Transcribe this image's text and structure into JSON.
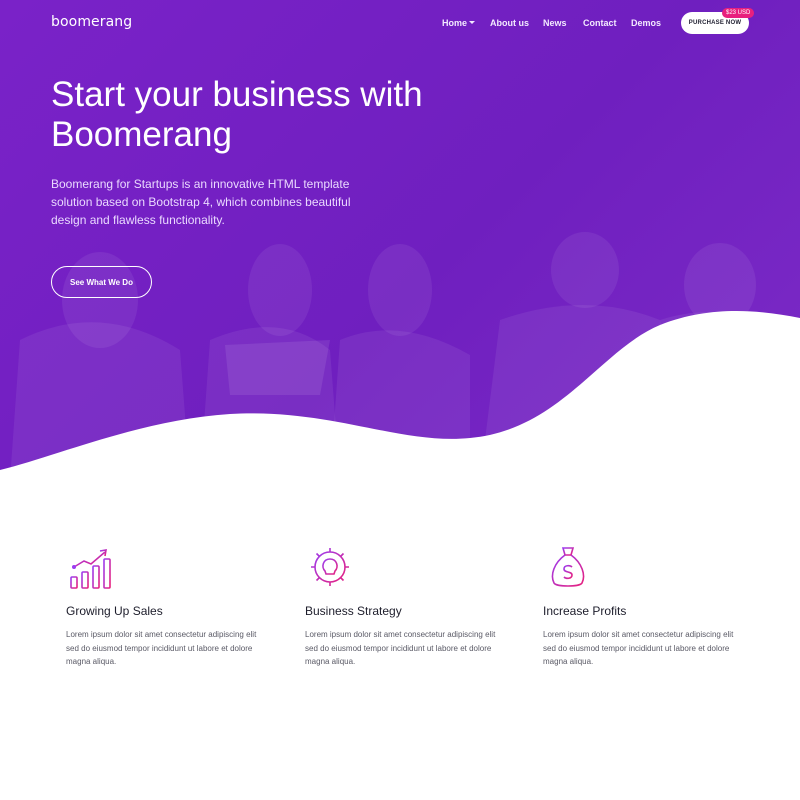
{
  "nav": {
    "logo": "boomerang",
    "items": [
      {
        "label": "Home",
        "has_dropdown": true
      },
      {
        "label": "About us"
      },
      {
        "label": "News"
      },
      {
        "label": "Contact"
      },
      {
        "label": "Demos"
      }
    ],
    "purchase_label": "PURCHASE NOW",
    "price_badge": "$23 USD"
  },
  "hero": {
    "title": "Start your business with Boomerang",
    "description": "Boomerang for Startups is an innovative HTML template solution based on Bootstrap 4, which combines beautiful design and flawless functionality.",
    "cta_label": "See What We Do"
  },
  "features": [
    {
      "icon": "growth-chart-icon",
      "title": "Growing Up Sales",
      "text": "Lorem ipsum dolor sit amet consectetur adipiscing elit sed do eiusmod tempor incididunt ut labore et dolore magna aliqua."
    },
    {
      "icon": "lightbulb-gear-icon",
      "title": "Business Strategy",
      "text": "Lorem ipsum dolor sit amet consectetur adipiscing elit sed do eiusmod tempor incididunt ut labore et dolore magna aliqua."
    },
    {
      "icon": "money-bag-icon",
      "title": "Increase Profits",
      "text": "Lorem ipsum dolor sit amet consectetur adipiscing elit sed do eiusmod tempor incididunt ut labore et dolore magna aliqua."
    }
  ],
  "colors": {
    "hero_purple": "#7a22c8",
    "badge_pink": "#e8207d",
    "icon_gradient_start": "#9b3cf0",
    "icon_gradient_end": "#e8207d"
  }
}
